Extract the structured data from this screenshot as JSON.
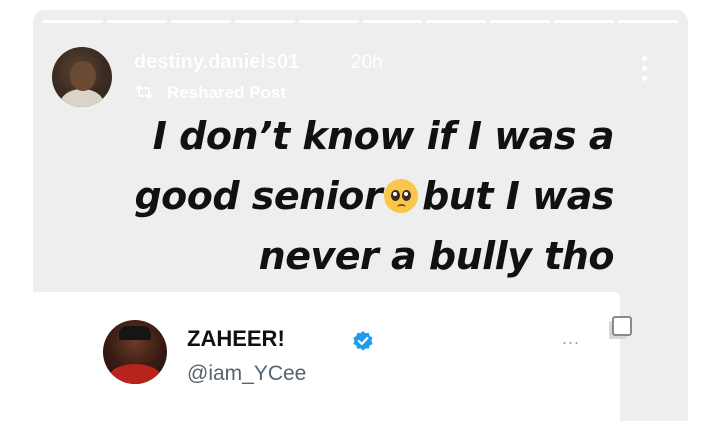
{
  "story": {
    "username": "destiny.daniels01",
    "time": "20h",
    "reshared_label": "Reshared Post",
    "progress_segments": 10,
    "caption_lines": [
      "I don’t know if I was a",
      "good senior",
      "but I was",
      "never a bully tho"
    ],
    "emoji": "pleading-face"
  },
  "tweet": {
    "display_name": "ZAHEER!",
    "handle": "@iam_YCee",
    "more": "...",
    "verified": true
  },
  "colors": {
    "story_bg": "#eeeeee",
    "caption": "#111111",
    "verified_blue": "#1d9bf0",
    "handle_gray": "#536471"
  }
}
